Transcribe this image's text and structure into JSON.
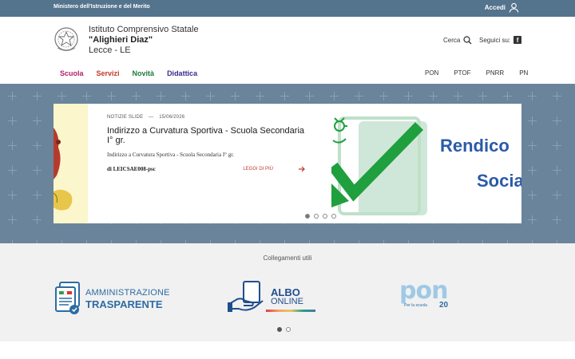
{
  "topbar": {
    "ministry": "Ministero dell'Istruzione e del Merito",
    "login_label": "Accedi"
  },
  "header": {
    "school_line1": "Istituto Comprensivo Statale",
    "school_line2": "\"Alighieri Diaz\"",
    "school_line3": "Lecce - LE",
    "search_label": "Cerca",
    "social_label": "Seguici su:",
    "main_nav": [
      {
        "label": "Scuola",
        "color": "#b0206a"
      },
      {
        "label": "Servizi",
        "color": "#c0392b"
      },
      {
        "label": "Novità",
        "color": "#1e7a3c"
      },
      {
        "label": "Didattica",
        "color": "#3a2a8c"
      }
    ],
    "secondary_nav": [
      "PON",
      "PTOF",
      "PNRR",
      "PN"
    ]
  },
  "slider": {
    "category": "NOTIZIE SLIDE",
    "separator": "—",
    "date": "15/06/2026",
    "title": "Indirizzo a Curvatura Sportiva - Scuola Secondaria I° gr.",
    "description": "Indirizzo a Curvatura Sportiva - Scuola Secondaria I° gr.",
    "author": "di LEICSAE008-psc",
    "read_more": "LEGGI DI PIÙ",
    "next_slide_line1": "Rendico",
    "next_slide_line2": "Socia",
    "dots": 4,
    "active_dot": 0
  },
  "links": {
    "title": "Collegamenti utili",
    "amministrazione_line1": "AMMINISTRAZIONE",
    "amministrazione_line2": "TRASPARENTE",
    "albo_line1": "ALBO",
    "albo_line2": "ONLINE",
    "pon_text": "pon",
    "pon_sub": "Per la scuola",
    "pon_years": "20",
    "dots": 2,
    "active_dot": 0
  },
  "colors": {
    "topbar": "#54738d",
    "hero": "#6a849b",
    "accent_red": "#c0392b",
    "link_blue": "#2d6ca3"
  }
}
